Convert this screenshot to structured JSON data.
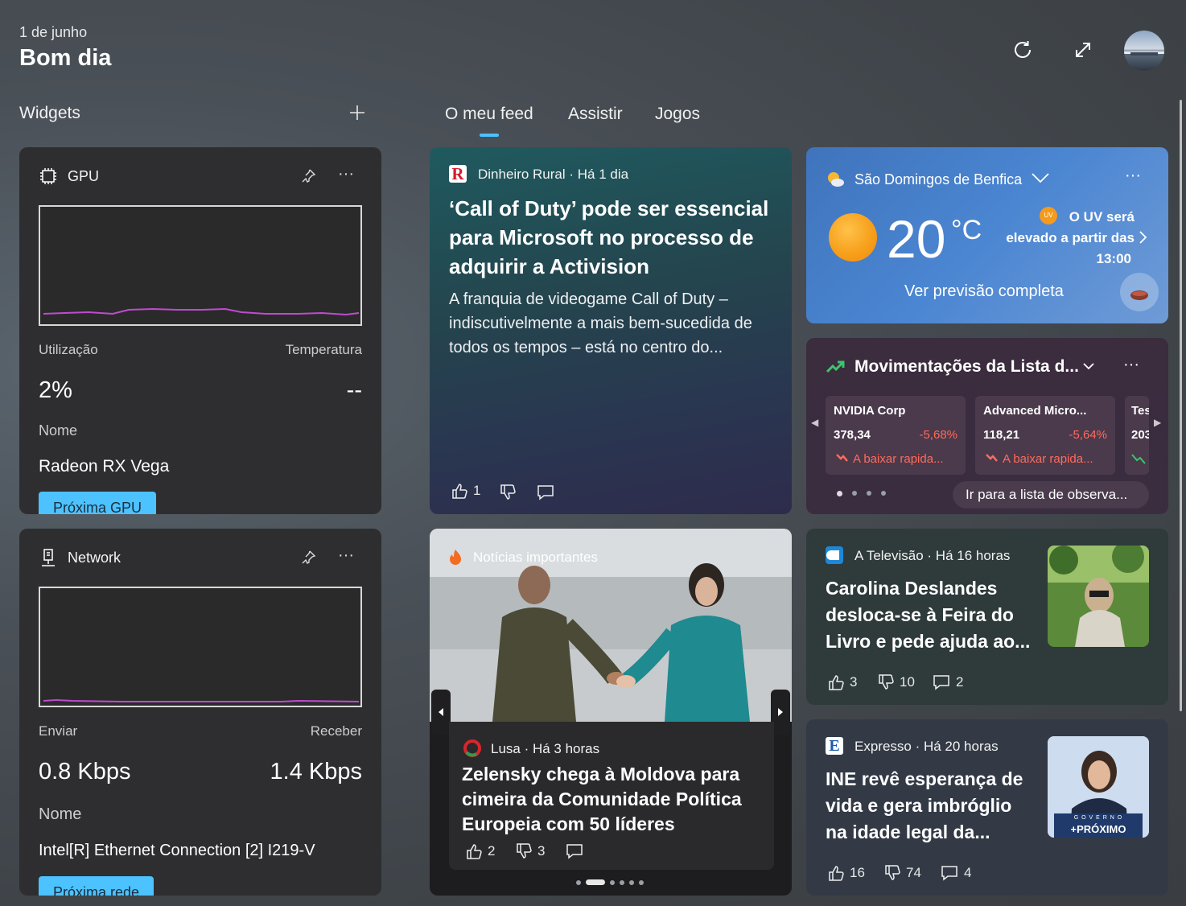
{
  "header": {
    "date": "1 de junho",
    "greeting": "Bom dia"
  },
  "widgets_panel": {
    "label": "Widgets",
    "tabs": [
      "O meu feed",
      "Assistir",
      "Jogos"
    ],
    "active_tab": "O meu feed"
  },
  "gpu_widget": {
    "title": "GPU",
    "label_left": "Utilização",
    "label_right": "Temperatura",
    "value_left": "2%",
    "value_right": "--",
    "name_label": "Nome",
    "name_value": "Radeon RX Vega",
    "button": "Próxima GPU"
  },
  "network_widget": {
    "title": "Network",
    "label_left": "Enviar",
    "label_right": "Receber",
    "value_left": "0.8 Kbps",
    "value_right": "1.4 Kbps",
    "name_label": "Nome",
    "name_value": "Intel[R] Ethernet Connection [2] I219-V",
    "button": "Próxima rede"
  },
  "news_main": {
    "source": "Dinheiro Rural · Há 1 dia",
    "headline": "‘Call of Duty’ pode ser essencial para Microsoft no processo de adquirir a Activision",
    "summary": "A franquia de videogame Call of Duty – indiscutivelmente a mais bem-sucedida de todos os tempos – está no centro do...",
    "likes": "1"
  },
  "weather": {
    "location": "São Domingos de Benfica",
    "temp": "20",
    "unit": "°C",
    "alert": "O UV será elevado a partir das 13:00",
    "alert_line1": "O UV será",
    "alert_line2": "elevado a partir das",
    "alert_line3": "13:00",
    "uv_badge": "UV",
    "link": "Ver previsão completa"
  },
  "watchlist": {
    "title": "Movimentações da Lista d...",
    "stocks": [
      {
        "name": "NVIDIA Corp",
        "price": "378,34",
        "change": "-5,68%",
        "trend": "A baixar rapida..."
      },
      {
        "name": "Advanced Micro...",
        "price": "118,21",
        "change": "-5,64%",
        "trend": "A baixar rapida..."
      },
      {
        "name": "Tes",
        "price": "203"
      }
    ],
    "link": "Ir para a lista de observa..."
  },
  "top_stories": {
    "label": "Notícias importantes",
    "source": "Lusa · Há 3 horas",
    "headline": "Zelensky chega à Moldova para cimeira da Comunidade Política Europeia com 50 líderes",
    "likes": "2",
    "dislikes": "3"
  },
  "news_tv": {
    "source": "A Televisão · Há 16 horas",
    "headline": "Carolina Deslandes desloca-se à Feira do Livro e pede ajuda ao...",
    "likes": "3",
    "dislikes": "10",
    "comments": "2"
  },
  "news_expresso": {
    "source": "Expresso · Há 20 horas",
    "headline": "INE revê esperança de vida e gera imbróglio na idade legal da...",
    "likes": "16",
    "dislikes": "74",
    "comments": "4",
    "thumb_text_top": "G O V E R N O",
    "thumb_text_bottom": "+PRÓXIMO"
  },
  "colors": {
    "accent": "#4cc2ff",
    "negative": "#ff6b5b",
    "graph_line": "#c04ad0"
  }
}
